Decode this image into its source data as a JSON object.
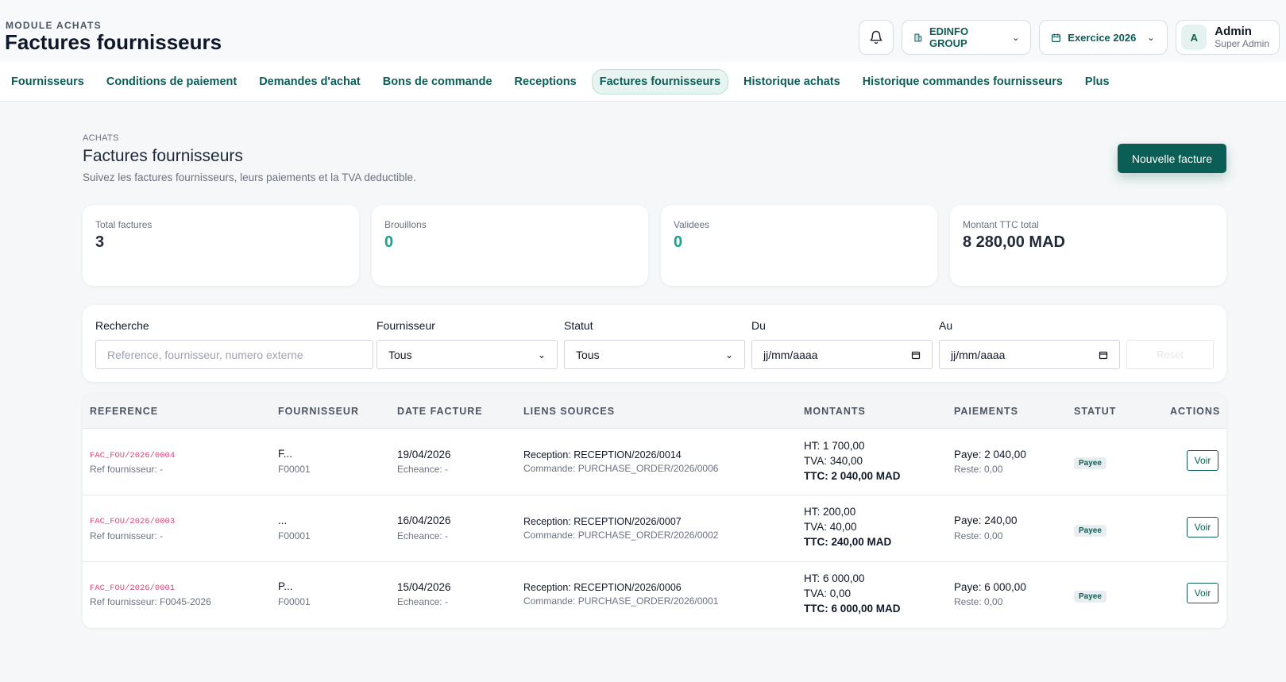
{
  "header": {
    "module_label": "MODULE ACHATS",
    "module_title": "Factures fournisseurs",
    "company": "EDINFO GROUP",
    "exercice": "Exercice 2026",
    "user_initial": "A",
    "user_name": "Admin",
    "user_role": "Super Admin"
  },
  "nav": {
    "items": [
      {
        "label": "Fournisseurs"
      },
      {
        "label": "Conditions de paiement"
      },
      {
        "label": "Demandes d'achat"
      },
      {
        "label": "Bons de commande"
      },
      {
        "label": "Receptions"
      },
      {
        "label": "Factures fournisseurs",
        "active": true
      },
      {
        "label": "Historique achats"
      },
      {
        "label": "Historique commandes fournisseurs"
      },
      {
        "label": "Plus"
      }
    ]
  },
  "page": {
    "breadcrumb": "ACHATS",
    "title": "Factures fournisseurs",
    "subtitle": "Suivez les factures fournisseurs, leurs paiements et la TVA deductible.",
    "new_button": "Nouvelle facture"
  },
  "stats": [
    {
      "label": "Total factures",
      "value": "3"
    },
    {
      "label": "Brouillons",
      "value": "0"
    },
    {
      "label": "Validees",
      "value": "0"
    },
    {
      "label": "Montant TTC total",
      "value": "8 280,00 MAD"
    }
  ],
  "filters": {
    "search_label": "Recherche",
    "search_placeholder": "Reference, fournisseur, numero externe",
    "supplier_label": "Fournisseur",
    "supplier_value": "Tous",
    "status_label": "Statut",
    "status_value": "Tous",
    "from_label": "Du",
    "from_placeholder": "jj/mm/aaaa",
    "to_label": "Au",
    "to_placeholder": "jj/mm/aaaa",
    "reset_label": "Reset"
  },
  "table": {
    "headers": [
      "REFERENCE",
      "FOURNISSEUR",
      "DATE FACTURE",
      "LIENS SOURCES",
      "MONTANTS",
      "PAIEMENTS",
      "STATUT",
      "ACTIONS"
    ],
    "rows": [
      {
        "reference": "FAC_FOU/2026/0004",
        "ref_fournisseur": "Ref fournisseur: -",
        "fournisseur_name": "F...",
        "fournisseur_code": "F00001",
        "date": "19/04/2026",
        "echeance": "Echeance: -",
        "reception": "Reception: RECEPTION/2026/0014",
        "commande": "Commande: PURCHASE_ORDER/2026/0006",
        "ht": "HT: 1 700,00",
        "tva": "TVA: 340,00",
        "ttc": "TTC: 2 040,00 MAD",
        "paye": "Paye: 2 040,00",
        "reste": "Reste: 0,00",
        "statut": "Payee",
        "action": "Voir"
      },
      {
        "reference": "FAC_FOU/2026/0003",
        "ref_fournisseur": "Ref fournisseur: -",
        "fournisseur_name": "...",
        "fournisseur_code": "F00001",
        "date": "16/04/2026",
        "echeance": "Echeance: -",
        "reception": "Reception: RECEPTION/2026/0007",
        "commande": "Commande: PURCHASE_ORDER/2026/0002",
        "ht": "HT: 200,00",
        "tva": "TVA: 40,00",
        "ttc": "TTC: 240,00 MAD",
        "paye": "Paye: 240,00",
        "reste": "Reste: 0,00",
        "statut": "Payee",
        "action": "Voir"
      },
      {
        "reference": "FAC_FOU/2026/0001",
        "ref_fournisseur": "Ref fournisseur: F0045-2026",
        "fournisseur_name": "P...",
        "fournisseur_code": "F00001",
        "date": "15/04/2026",
        "echeance": "Echeance: -",
        "reception": "Reception: RECEPTION/2026/0006",
        "commande": "Commande: PURCHASE_ORDER/2026/0001",
        "ht": "HT: 6 000,00",
        "tva": "TVA: 0,00",
        "ttc": "TTC: 6 000,00 MAD",
        "paye": "Paye: 6 000,00",
        "reste": "Reste: 0,00",
        "statut": "Payee",
        "action": "Voir"
      }
    ]
  }
}
